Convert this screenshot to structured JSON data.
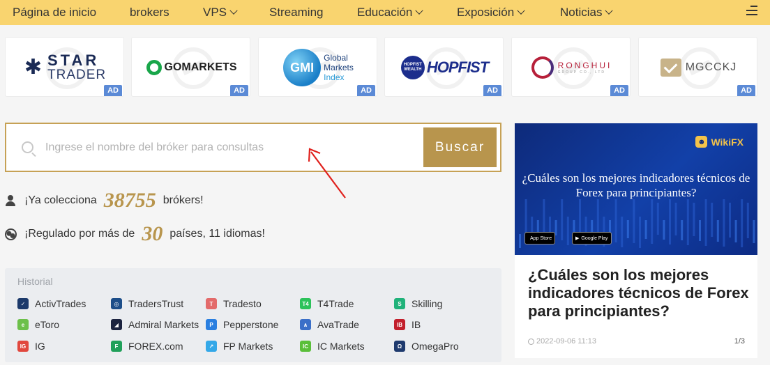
{
  "nav": {
    "items": [
      {
        "label": "Página de inicio",
        "dropdown": false
      },
      {
        "label": "brokers",
        "dropdown": false
      },
      {
        "label": "VPS",
        "dropdown": true
      },
      {
        "label": "Streaming",
        "dropdown": false
      },
      {
        "label": "Educación",
        "dropdown": true
      },
      {
        "label": "Exposición",
        "dropdown": true
      },
      {
        "label": "Noticias",
        "dropdown": true
      }
    ],
    "menu_icon": "hamburger-icon"
  },
  "brokers_ads": [
    {
      "name": "STAR TRADER",
      "line1": "STAR",
      "line2": "TRADER",
      "badge": "AD"
    },
    {
      "name": "GO MARKETS",
      "text": "GOMARKETS",
      "badge": "AD"
    },
    {
      "name": "GMI Global Markets Index",
      "mark": "GMI",
      "line1": "Global",
      "line2": "Markets",
      "line3": "Index",
      "badge": "AD"
    },
    {
      "name": "HOPFIST",
      "mark": "HOPFIST WEALTH",
      "text": "HOPFIST",
      "badge": "AD"
    },
    {
      "name": "RONGHUI",
      "line1": "RONGHUI",
      "line2": "GROUP CO., LTD",
      "badge": "AD"
    },
    {
      "name": "MGCCKJ",
      "text": "MGCCKJ",
      "badge": "AD"
    }
  ],
  "search": {
    "placeholder": "Ingrese el nombre del bróker para consultas",
    "value": "",
    "button_label": "Buscar"
  },
  "stats": {
    "collect_prefix": "¡Ya colecciona",
    "collect_count": "38755",
    "collect_suffix": "brókers!",
    "regulated_prefix": "¡Regulado por más de",
    "regulated_count": "30",
    "regulated_suffix": "países, 11 idiomas!"
  },
  "historial": {
    "title": "Historial",
    "items": [
      {
        "label": "ActivTrades",
        "color": "#1c3a6b",
        "glyph": "✓"
      },
      {
        "label": "TradersTrust",
        "color": "#1d4e89",
        "glyph": "◎"
      },
      {
        "label": "Tradesto",
        "color": "#e36b6b",
        "glyph": "T"
      },
      {
        "label": "T4Trade",
        "color": "#2cc25a",
        "glyph": "T4"
      },
      {
        "label": "Skilling",
        "color": "#20b27a",
        "glyph": "S"
      },
      {
        "label": "eToro",
        "color": "#6cc04a",
        "glyph": "e"
      },
      {
        "label": "Admiral Markets",
        "color": "#1c2440",
        "glyph": "◢"
      },
      {
        "label": "Pepperstone",
        "color": "#2a7fe0",
        "glyph": "P"
      },
      {
        "label": "AvaTrade",
        "color": "#3a6fc8",
        "glyph": "∧"
      },
      {
        "label": "IB",
        "color": "#c21f2c",
        "glyph": "IB"
      },
      {
        "label": "IG",
        "color": "#e1483e",
        "glyph": "IG"
      },
      {
        "label": "FOREX.com",
        "color": "#20a05a",
        "glyph": "F"
      },
      {
        "label": "FP Markets",
        "color": "#33a8e8",
        "glyph": "↗"
      },
      {
        "label": "IC Markets",
        "color": "#5abf3a",
        "glyph": "IC"
      },
      {
        "label": "OmegaPro",
        "color": "#1e3a6e",
        "glyph": "Ω"
      }
    ]
  },
  "news": {
    "brand": "WikiFX",
    "banner_title": "¿Cuáles son los mejores indicadores técnicos de Forex para principiantes?",
    "store1": "App Store",
    "store2": "Google Play",
    "title": "¿Cuáles son los mejores indicadores técnicos de Forex para principiantes?",
    "date": "2022-09-06 11:13",
    "page": "1/3"
  }
}
